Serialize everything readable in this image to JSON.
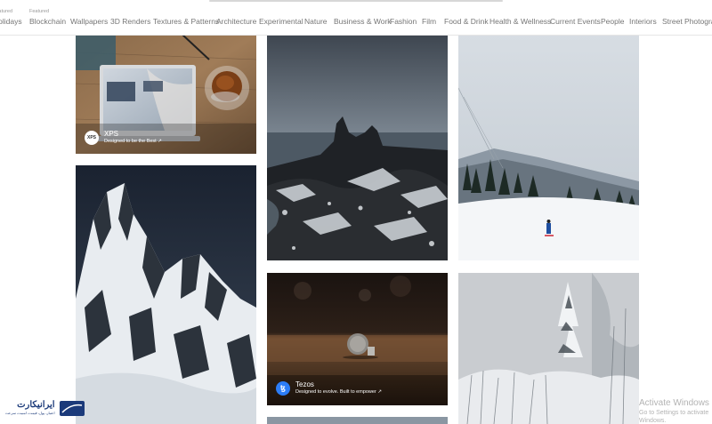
{
  "nav": {
    "featured_label": "Featured",
    "items": [
      {
        "label": "Holidays",
        "featured": true
      },
      {
        "label": "Blockchain",
        "featured": true
      },
      {
        "label": "Wallpapers"
      },
      {
        "label": "3D Renders"
      },
      {
        "label": "Textures & Patterns"
      },
      {
        "label": "Architecture"
      },
      {
        "label": "Experimental"
      },
      {
        "label": "Nature"
      },
      {
        "label": "Business & Work"
      },
      {
        "label": "Fashion"
      },
      {
        "label": "Film"
      },
      {
        "label": "Food & Drink"
      },
      {
        "label": "Health & Wellness"
      },
      {
        "label": "Current Events"
      },
      {
        "label": "People"
      },
      {
        "label": "Interiors"
      },
      {
        "label": "Street Photography"
      }
    ]
  },
  "gallery": {
    "tiles": [
      {
        "name": "laptop-tea-photo",
        "sponsor": {
          "brand": "XPS",
          "tagline": "Designed to be the Best ↗"
        }
      },
      {
        "name": "rocky-coast-photo"
      },
      {
        "name": "skier-snow-photo"
      },
      {
        "name": "snowy-peak-photo"
      },
      {
        "name": "coin-photo",
        "sponsor": {
          "brand": "Tezos",
          "tagline": "Designed to evolve. Built to empower ↗",
          "badge": "ꜩ"
        }
      },
      {
        "name": "snowy-trees-photo"
      },
      {
        "name": "bottom-cut-photo"
      }
    ]
  },
  "watermark": {
    "windows_title": "Activate Windows",
    "windows_sub": "Go to Settings to activate Windows.",
    "logo_text": "ایرانیکارت",
    "logo_sub": "اعتبار، پول، قیمت، امنیت، سرعت"
  },
  "colors": {
    "nav_text": "#767676",
    "tezos_blue": "#2c7df7"
  }
}
